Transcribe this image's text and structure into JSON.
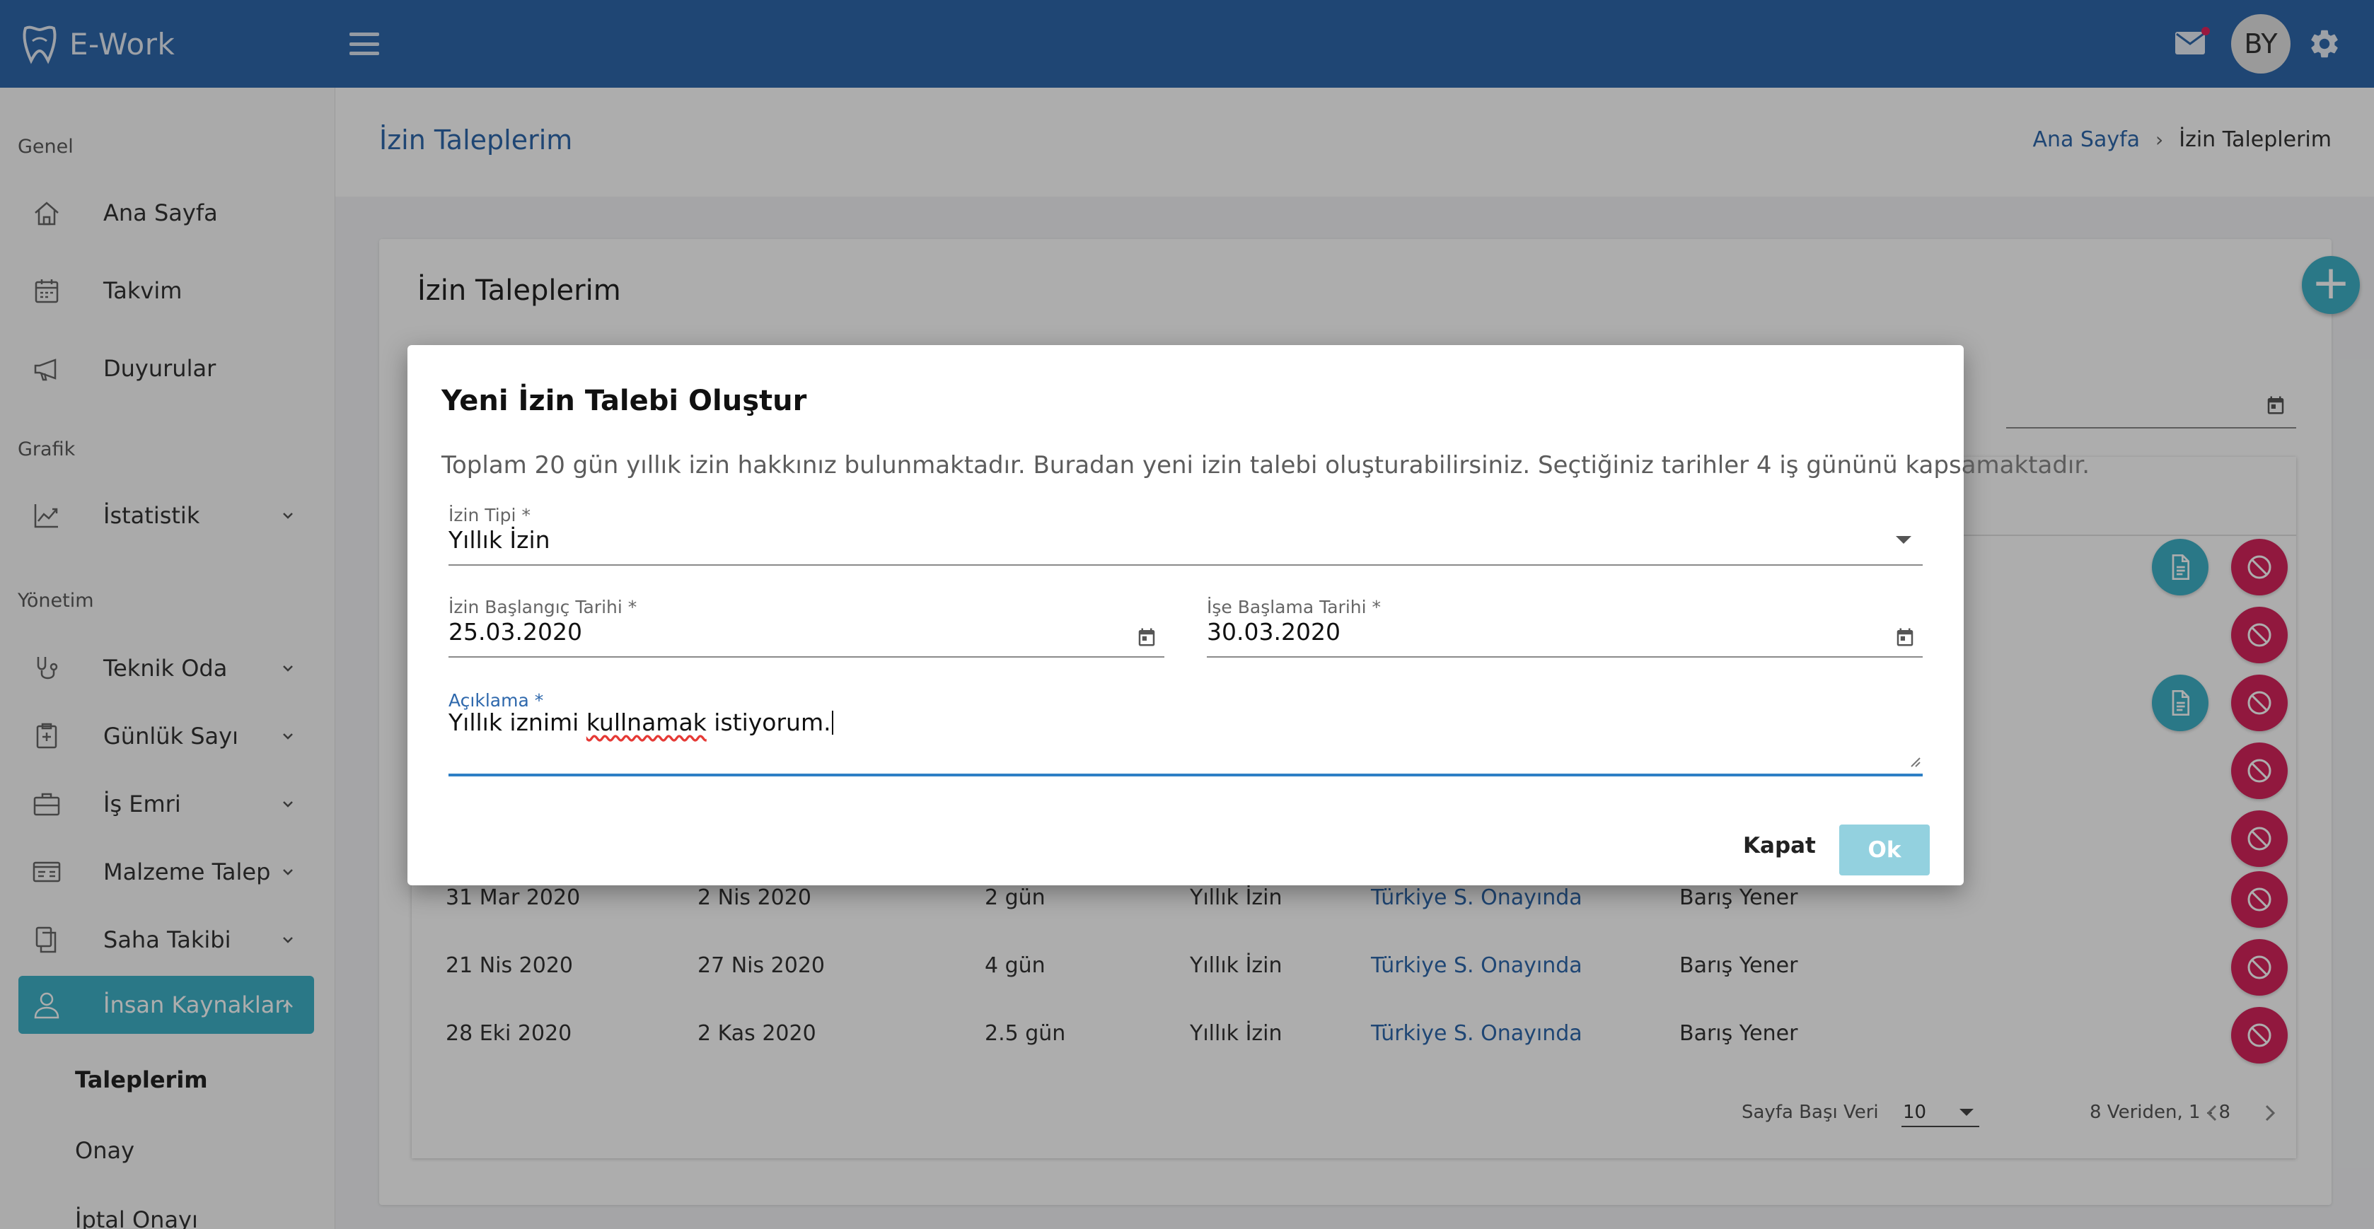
{
  "app": {
    "name": "E-Work"
  },
  "topbar": {
    "avatar_initials": "BY"
  },
  "sidebar": {
    "sections": {
      "genel": "Genel",
      "grafik": "Grafik",
      "yonetim": "Yönetim"
    },
    "items": {
      "ana_sayfa": "Ana Sayfa",
      "takvim": "Takvim",
      "duyurular": "Duyurular",
      "istatistik": "İstatistik",
      "teknik_oda": "Teknik Oda",
      "gunluk_sayi": "Günlük Sayı",
      "is_emri": "İş Emri",
      "malzeme_talep": "Malzeme Talep",
      "saha_takibi": "Saha Takibi",
      "insan_kaynaklari": "İnsan Kaynakları"
    },
    "sub_items": {
      "taleplerim": "Taleplerim",
      "onay": "Onay",
      "iptal_onayi": "İptal Onayı"
    }
  },
  "page": {
    "title": "İzin Taleplerim",
    "breadcrumb": {
      "home": "Ana Sayfa",
      "current": "İzin Taleplerim"
    },
    "card_title": "İzin Taleplerim"
  },
  "table": {
    "rows": [
      {
        "start": "31 Mar 2020",
        "end": "2 Nis 2020",
        "duration": "2 gün",
        "type": "Yıllık İzin",
        "status": "Türkiye S. Onayında",
        "person": "Barış Yener"
      },
      {
        "start": "21 Nis 2020",
        "end": "27 Nis 2020",
        "duration": "4 gün",
        "type": "Yıllık İzin",
        "status": "Türkiye S. Onayında",
        "person": "Barış Yener"
      },
      {
        "start": "28 Eki 2020",
        "end": "2 Kas 2020",
        "duration": "2.5 gün",
        "type": "Yıllık İzin",
        "status": "Türkiye S. Onayında",
        "person": "Barış Yener"
      }
    ],
    "pagination": {
      "per_page_label": "Sayfa Başı Veri",
      "per_page_value": "10",
      "range": "8 Veriden, 1 - 8"
    }
  },
  "colors": {
    "primary": "#2e68ac",
    "accent": "#3eb1c8",
    "danger": "#d6245c",
    "ok_button": "#93d1df"
  },
  "modal": {
    "title": "Yeni İzin Talebi Oluştur",
    "description": "Toplam 20 gün yıllık izin hakkınız bulunmaktadır. Buradan yeni izin talebi oluşturabilirsiniz. Seçtiğiniz tarihler 4 iş gününü kapsamaktadır.",
    "leave_type": {
      "label": "İzin Tipi *",
      "value": "Yıllık İzin"
    },
    "start_date": {
      "label": "İzin Başlangıç Tarihi *",
      "value": "25.03.2020"
    },
    "return_date": {
      "label": "İşe Başlama Tarihi *",
      "value": "30.03.2020"
    },
    "description_field": {
      "label": "Açıklama *",
      "text_before": "Yıllık iznimi ",
      "text_misspelled": "kullnamak",
      "text_after": " istiyorum."
    },
    "close_label": "Kapat",
    "ok_label": "Ok"
  }
}
